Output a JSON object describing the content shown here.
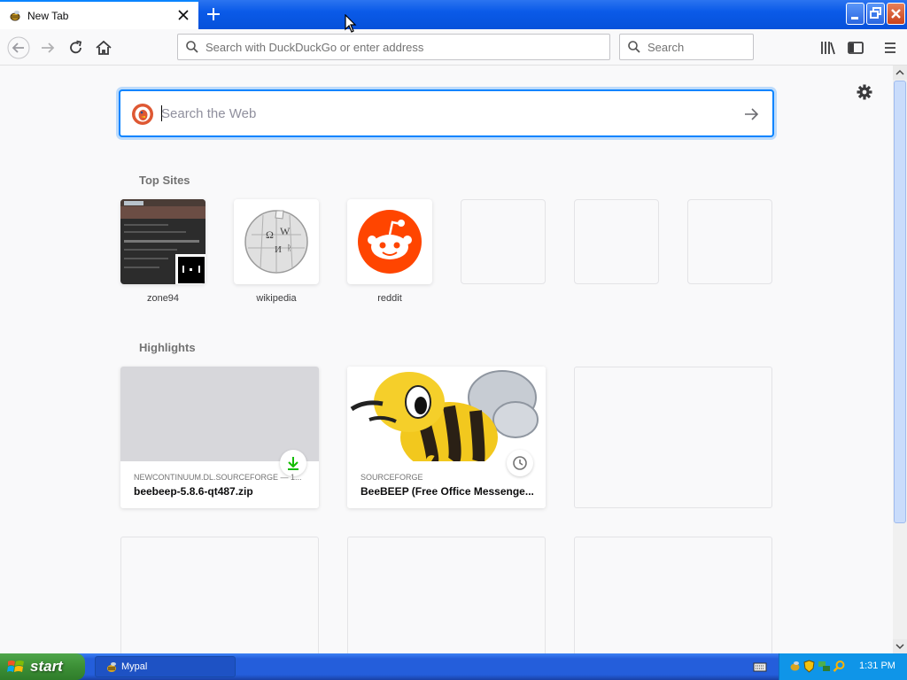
{
  "browser": {
    "tab_title": "New Tab",
    "urlbar_placeholder": "Search with DuckDuckGo or enter address",
    "searchbar_placeholder": "Search"
  },
  "newtab": {
    "web_search_placeholder": "Search the Web",
    "top_sites_title": "Top Sites",
    "top_sites": [
      {
        "label": "zone94"
      },
      {
        "label": "wikipedia"
      },
      {
        "label": "reddit"
      }
    ],
    "highlights_title": "Highlights",
    "highlights": [
      {
        "host": "NEWCONTINUUM.DL.SOURCEFORGE — 1...",
        "title": "beebeep-5.8.6-qt487.zip",
        "badge": "download-icon"
      },
      {
        "host": "SOURCEFORGE",
        "title": "BeeBEEP (Free Office Messenge...",
        "badge": "clock-icon"
      }
    ]
  },
  "taskbar": {
    "start_label": "start",
    "window_label": "Mypal",
    "clock": "1:31 PM"
  },
  "colors": {
    "accent": "#0a84ff",
    "reddit": "#ff4500",
    "ddg": "#de5833"
  }
}
